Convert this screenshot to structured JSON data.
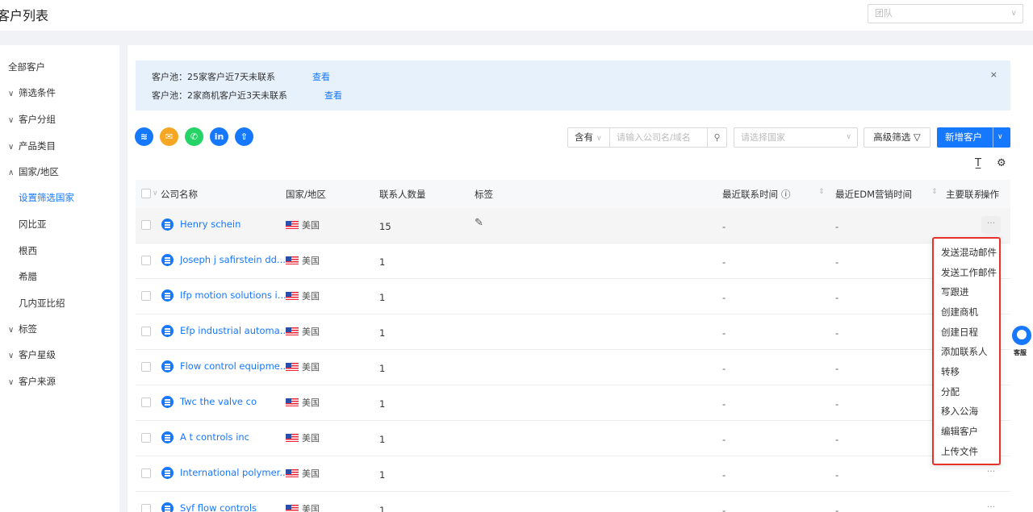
{
  "page": {
    "title": "客户列表",
    "team_placeholder": "团队"
  },
  "sidebar": {
    "items": [
      {
        "label": "全部客户",
        "arrow": ""
      },
      {
        "label": "筛选条件",
        "arrow": "∨"
      },
      {
        "label": "客户分组",
        "arrow": "∨"
      },
      {
        "label": "产品类目",
        "arrow": "∨"
      },
      {
        "label": "国家/地区",
        "arrow": "∧"
      },
      {
        "label": "设置筛选国家",
        "arrow": "",
        "sub": true,
        "active": true
      },
      {
        "label": "冈比亚",
        "arrow": "",
        "sub": true
      },
      {
        "label": "根西",
        "arrow": "",
        "sub": true
      },
      {
        "label": "希腊",
        "arrow": "",
        "sub": true
      },
      {
        "label": "几内亚比绍",
        "arrow": "",
        "sub": true
      },
      {
        "label": "标签",
        "arrow": "∨"
      },
      {
        "label": "客户星级",
        "arrow": "∨"
      },
      {
        "label": "客户来源",
        "arrow": "∨"
      }
    ]
  },
  "notice": {
    "line1": "客户池：25家客户近7天未联系",
    "line2": "客户池：2家商机客户近3天未联系",
    "link": "查看",
    "close": "×"
  },
  "toolbar": {
    "contains": "含有",
    "search_placeholder": "请输入公司名/域名",
    "country_placeholder": "请选择国家",
    "advanced_filter": "高级筛选",
    "new_customer": "新增客户"
  },
  "table": {
    "headers": {
      "company": "公司名称",
      "country": "国家/地区",
      "contacts": "联系人数量",
      "tags": "标签",
      "last_contact": "最近联系时间",
      "last_edm": "最近EDM营销时间",
      "main_contact": "主要联系",
      "actions": "操作"
    },
    "rows": [
      {
        "company": "Henry schein",
        "country": "美国",
        "contacts": "15",
        "last_contact": "-",
        "last_edm": "-",
        "more": "···"
      },
      {
        "company": "Joseph j safirstein dd...",
        "country": "美国",
        "contacts": "1",
        "last_contact": "-",
        "last_edm": "-",
        "more": "···"
      },
      {
        "company": "Ifp motion solutions i...",
        "country": "美国",
        "contacts": "1",
        "last_contact": "-",
        "last_edm": "-",
        "more": "···"
      },
      {
        "company": "Efp industrial automa...",
        "country": "美国",
        "contacts": "1",
        "last_contact": "-",
        "last_edm": "-",
        "more": "···"
      },
      {
        "company": "Flow control equipme...",
        "country": "美国",
        "contacts": "1",
        "last_contact": "-",
        "last_edm": "-",
        "more": "···"
      },
      {
        "company": "Twc the valve co",
        "country": "美国",
        "contacts": "1",
        "last_contact": "-",
        "last_edm": "-",
        "more": "···"
      },
      {
        "company": "A t controls inc",
        "country": "美国",
        "contacts": "1",
        "last_contact": "-",
        "last_edm": "-",
        "more": "···"
      },
      {
        "company": "International polymer...",
        "country": "美国",
        "contacts": "1",
        "last_contact": "-",
        "last_edm": "-",
        "more": "···"
      },
      {
        "company": "Syf flow controls",
        "country": "美国",
        "contacts": "1",
        "last_contact": "-",
        "last_edm": "-",
        "more": "···"
      }
    ]
  },
  "action_menu": {
    "items": [
      "发送混动邮件",
      "发送工作邮件",
      "写跟进",
      "创建商机",
      "创建日程",
      "添加联系人",
      "转移",
      "分配",
      "移入公海",
      "编辑客户",
      "上传文件"
    ]
  },
  "customer_service": {
    "label": "客服"
  },
  "icons": {
    "social": [
      "layers-icon",
      "mail-icon",
      "whatsapp-icon",
      "linkedin-icon",
      "share-icon"
    ],
    "social_colors": [
      "#1677ff",
      "#f5a623",
      "#25d366",
      "#1677ff",
      "#1677ff"
    ],
    "social_glyphs": [
      "≋",
      "✉",
      "✆",
      "in",
      "⇧"
    ]
  },
  "colors": {
    "accent": "#1677ff",
    "highlight_border": "#e8312a",
    "notice_bg": "#e6f1fc"
  }
}
